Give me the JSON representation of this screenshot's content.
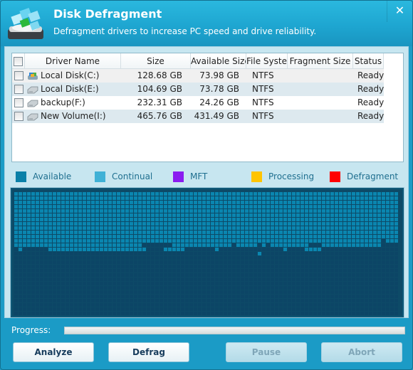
{
  "window": {
    "title": "Disk Defragment",
    "subtitle": "Defragment drivers to increase PC speed and drive reliability.",
    "close_label": "✕"
  },
  "table": {
    "columns": [
      "",
      "Driver Name",
      "Size",
      "Available Size",
      "File System",
      "Fragment Size",
      "Status"
    ],
    "rows": [
      {
        "name": "Local Disk(C:)",
        "icon": "system-drive-icon",
        "size": "128.68 GB",
        "available": "73.98 GB",
        "fs": "NTFS",
        "fragment": "",
        "status": "Ready"
      },
      {
        "name": "Local Disk(E:)",
        "icon": "drive-icon",
        "size": "104.69 GB",
        "available": "73.78 GB",
        "fs": "NTFS",
        "fragment": "",
        "status": "Ready"
      },
      {
        "name": "backup(F:)",
        "icon": "drive-icon",
        "size": "232.31 GB",
        "available": "24.26 GB",
        "fs": "NTFS",
        "fragment": "",
        "status": "Ready"
      },
      {
        "name": "New Volume(I:)",
        "icon": "drive-icon",
        "size": "465.76 GB",
        "available": "431.49 GB",
        "fs": "NTFS",
        "fragment": "",
        "status": "Ready"
      }
    ]
  },
  "legend": [
    {
      "label": "Available",
      "color": "#0a80a8"
    },
    {
      "label": "Continual",
      "color": "#3fb1d6"
    },
    {
      "label": "MFT",
      "color": "#8a1cf0"
    },
    {
      "label": "Processing",
      "color": "#ffc400"
    },
    {
      "label": "Defragment",
      "color": "#ff0000"
    }
  ],
  "map": {
    "columns": 90,
    "rows": 29,
    "colors": {
      "A": "#0a86b0",
      "E": "#0c4566",
      "grid": "#1b5c78"
    },
    "full_available_rows": 11,
    "partial_rows": [
      "AAAAAAAAAAAAAAAAAAAAAAAAAAAAAAAAAAAAAAAAAAAAAAAAAAAAAAAAAAAAAAAAAAAAAAAAAAAAAAAAAAAAAAEAAA",
      "AAAAAAAAAAAAAAAAAAAAAAAAAAAAAAEEEEEEEAAAAAAAAAAAAAAEAAAAAEAEAAAAAAAAAEEEAAAAAAAAAAAAAAEEEE",
      "EAEEEEEEAAAAAAAAAAAAAAAAAAAAAAAEEEEAAAAAEEEEEEEAEEEEEEEEEEEEEEEAEEEEAAAAEEEEEEEEEEEEEEEEEEEEEE",
      "EEEEEEEEEEEEEEEEEEEEEEEEEEEEEEEEEEEEEEEEEEEEEEEEEEEEEEEEEAEEEEEEEEEEEEEEEEEEEEEEEEEEEEEEEEEE"
    ]
  },
  "progress": {
    "label": "Progress:",
    "value": 0
  },
  "buttons": {
    "analyze": "Analyze",
    "defrag": "Defrag",
    "pause": "Pause",
    "abort": "Abort"
  }
}
